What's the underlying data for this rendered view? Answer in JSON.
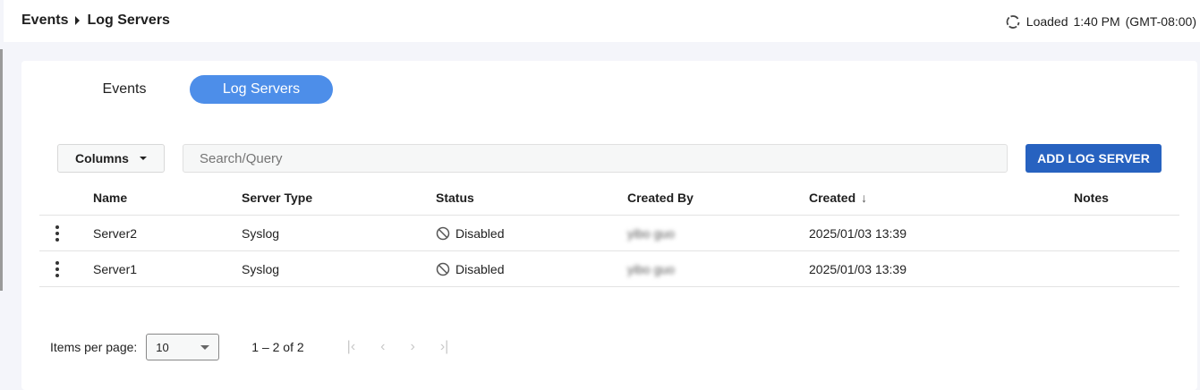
{
  "breadcrumb": [
    "Events",
    "Log Servers"
  ],
  "status": {
    "label": "Loaded",
    "time": "1:40 PM",
    "timezone": "(GMT-08:00)"
  },
  "tabs": [
    {
      "label": "Events",
      "active": false
    },
    {
      "label": "Log Servers",
      "active": true
    }
  ],
  "toolbar": {
    "columns_label": "Columns",
    "search_placeholder": "Search/Query",
    "add_label": "ADD LOG SERVER"
  },
  "table": {
    "headers": [
      "Name",
      "Server Type",
      "Status",
      "Created By",
      "Created",
      "Notes"
    ],
    "sort_indicator": "↓",
    "rows": [
      {
        "name": "Server2",
        "type": "Syslog",
        "status": "Disabled",
        "created_by": "yibo guo",
        "created": "2025/01/03 13:39",
        "notes": ""
      },
      {
        "name": "Server1",
        "type": "Syslog",
        "status": "Disabled",
        "created_by": "yibo guo",
        "created": "2025/01/03 13:39",
        "notes": ""
      }
    ]
  },
  "pagination": {
    "items_label": "Items per page:",
    "page_size": "10",
    "range": "1 – 2 of 2"
  },
  "colors": {
    "accent": "#4d8ee9",
    "primary_button": "#2762c0"
  }
}
